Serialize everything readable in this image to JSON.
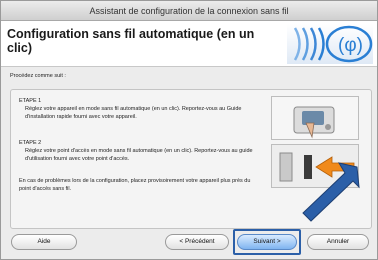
{
  "window": {
    "title": "Assistant de configuration de la connexion sans fil"
  },
  "header": {
    "title": "Configuration sans fil automatique (en un clic)"
  },
  "main": {
    "intro": "Procédez comme suit :",
    "steps": [
      {
        "title": "ETAPE 1",
        "text": "Réglez votre appareil en mode sans fil automatique (en un clic). Reportez-vous au Guide d'installation rapide fourni avec votre appareil."
      },
      {
        "title": "ETAPE 2",
        "text": "Réglez votre point d'accès en mode sans fil automatique (en un clic). Reportez-vous au guide d'utilisation fourni avec votre point d'accès."
      }
    ],
    "help": "En cas de problèmes lors de la configuration, placez provisoirement votre appareil plus près du point d'accès sans fil."
  },
  "buttons": {
    "help": "Aide",
    "previous": "< Précédent",
    "next": "Suivant >",
    "cancel": "Annuler"
  },
  "colors": {
    "accent_arrow": "#2b5fa8",
    "step2_arrow": "#f08a1c",
    "logo_blue": "#2a7fd4"
  }
}
